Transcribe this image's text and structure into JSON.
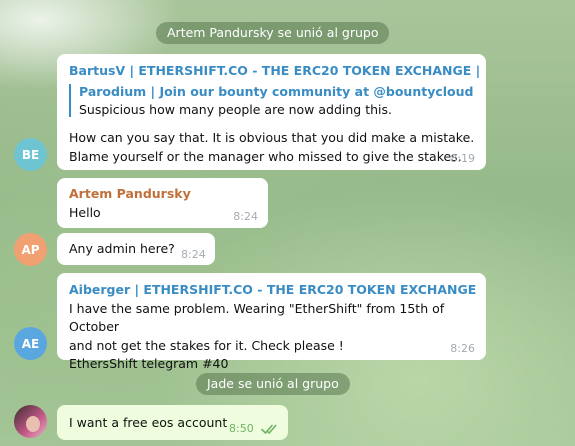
{
  "service_messages": [
    "Artem Pandursky se unió al grupo",
    "Jade se unió al grupo"
  ],
  "messages": [
    {
      "avatar": "BE",
      "sender": "BartusV | ETHERSHIFT.CO - THE ERC20 TOKEN EXCHANGE |",
      "quote_name": "Parodium | Join our bounty community at @bountycloud",
      "quote_text": "Suspicious how many people are now adding this.",
      "lines": [
        "How can you say that. It is obvious that you did make a mistake.",
        "Blame yourself or the manager who missed to give the stakes."
      ],
      "time": "8:19"
    },
    {
      "sender": "Artem Pandursky",
      "text": "Hello",
      "time": "8:24"
    },
    {
      "avatar": "AP",
      "text": "Any admin here?",
      "time": "8:24"
    },
    {
      "avatar": "AE",
      "sender": "Aiberger | ETHERSHIFT.CO - THE ERC20 TOKEN EXCHANGE",
      "lines": [
        "I have the same problem. Wearing \"EtherShift\" from 15th of October",
        "and not get the stakes for it. Check please !",
        "EthersShift telegram #40"
      ],
      "time": "8:26"
    },
    {
      "text": "I want a free eos account",
      "time": "8:50",
      "status": "read-double-check-icon"
    }
  ],
  "colors": {
    "accent_blue": "#3a8cc4",
    "sender_orange": "#c0703a",
    "outgoing_bubble": "#effdde",
    "read_check": "#6db566"
  }
}
